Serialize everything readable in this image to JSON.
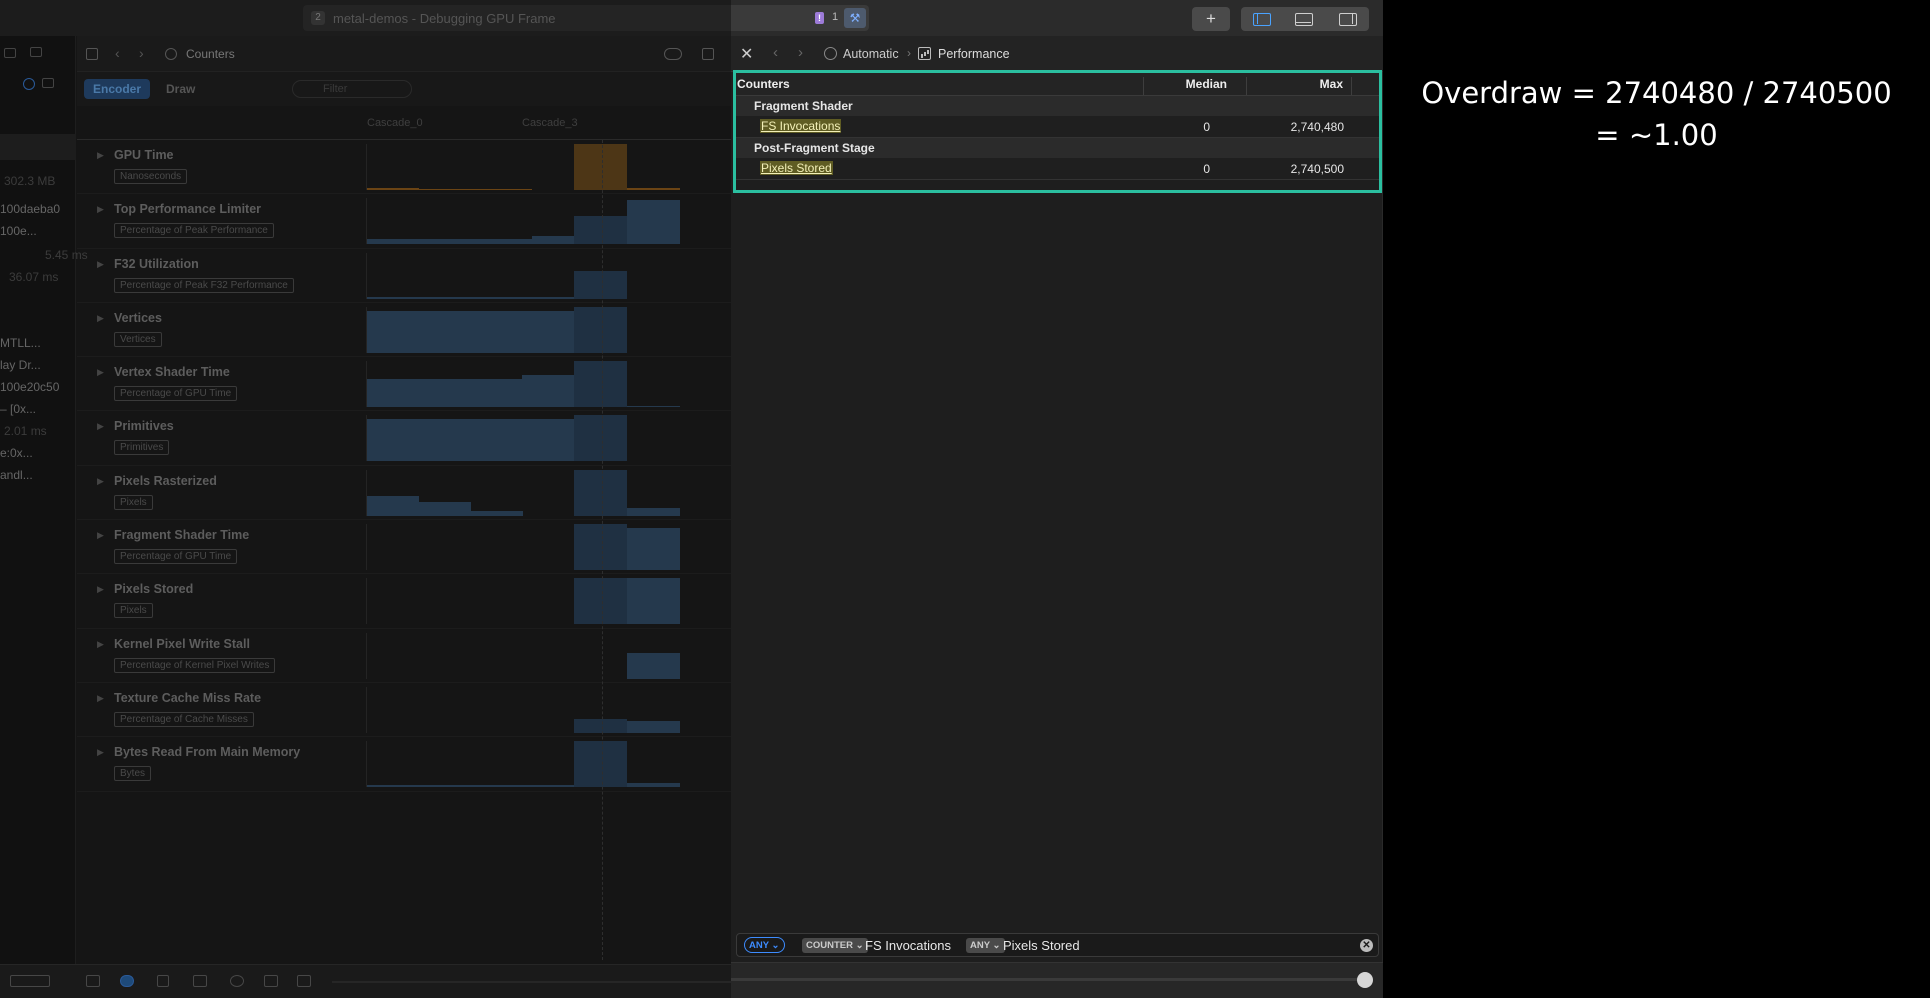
{
  "window": {
    "title": "metal-demos - Debugging GPU Frame",
    "title_index": "2",
    "issues_badge": "!",
    "issues_count": "1"
  },
  "far_left": {
    "items": [
      {
        "text": "302.3 MB",
        "dim": true
      },
      {
        "text": "100daeba0",
        "dim": false
      },
      {
        "text": "100e...",
        "dim": false
      },
      {
        "text": "5.45 ms",
        "dim": true
      },
      {
        "text": "36.07 ms",
        "dim": true
      },
      {
        "text": "MTLL...",
        "dim": false
      },
      {
        "text": "lay Dr...",
        "dim": false
      },
      {
        "text": "100e20c50",
        "dim": false
      },
      {
        "text": "– [0x...",
        "dim": false
      },
      {
        "text": "2.01 ms",
        "dim": true
      },
      {
        "text": "e:0x...",
        "dim": false
      },
      {
        "text": "andl...",
        "dim": false
      }
    ]
  },
  "nav": {
    "title": "Counters"
  },
  "tabs": {
    "encoder": "Encoder",
    "draw": "Draw",
    "filter_placeholder": "Filter"
  },
  "cascades": [
    "Cascade_0",
    "Cascade_3"
  ],
  "counters": [
    {
      "name": "GPU Time",
      "unit": "Nanoseconds"
    },
    {
      "name": "Top Performance Limiter",
      "unit": "Percentage of Peak Performance"
    },
    {
      "name": "F32 Utilization",
      "unit": "Percentage of Peak F32 Performance"
    },
    {
      "name": "Vertices",
      "unit": "Vertices"
    },
    {
      "name": "Vertex Shader Time",
      "unit": "Percentage of GPU Time"
    },
    {
      "name": "Primitives",
      "unit": "Primitives"
    },
    {
      "name": "Pixels Rasterized",
      "unit": "Pixels"
    },
    {
      "name": "Fragment Shader Time",
      "unit": "Percentage of GPU Time"
    },
    {
      "name": "Pixels Stored",
      "unit": "Pixels"
    },
    {
      "name": "Kernel Pixel Write Stall",
      "unit": "Percentage of Kernel Pixel Writes"
    },
    {
      "name": "Texture Cache Miss Rate",
      "unit": "Percentage of Cache Misses"
    },
    {
      "name": "Bytes Read From Main Memory",
      "unit": "Bytes"
    }
  ],
  "perf_panel": {
    "breadcrumb": {
      "auto": "Automatic",
      "current": "Performance"
    },
    "table": {
      "headers": {
        "counters": "Counters",
        "median": "Median",
        "max": "Max"
      },
      "groups": [
        {
          "name": "Fragment Shader",
          "rows": [
            {
              "name": "FS Invocations",
              "median": "0",
              "max": "2,740,480"
            }
          ]
        },
        {
          "name": "Post-Fragment Stage",
          "rows": [
            {
              "name": "Pixels Stored",
              "median": "0",
              "max": "2,740,500"
            }
          ]
        }
      ]
    },
    "filter": {
      "token1": "ANY",
      "token2": "COUNTER",
      "text1": "FS Invocations",
      "token3": "ANY",
      "text2": "Pixels Stored"
    }
  },
  "annotation": {
    "line1": "Overdraw = 2740480 / 2740500",
    "line2": "= ~1.00"
  },
  "colors": {
    "highlight_border": "#2bbfa0",
    "match_highlight": "#5f5c23",
    "accent_blue": "#3d8cff"
  }
}
